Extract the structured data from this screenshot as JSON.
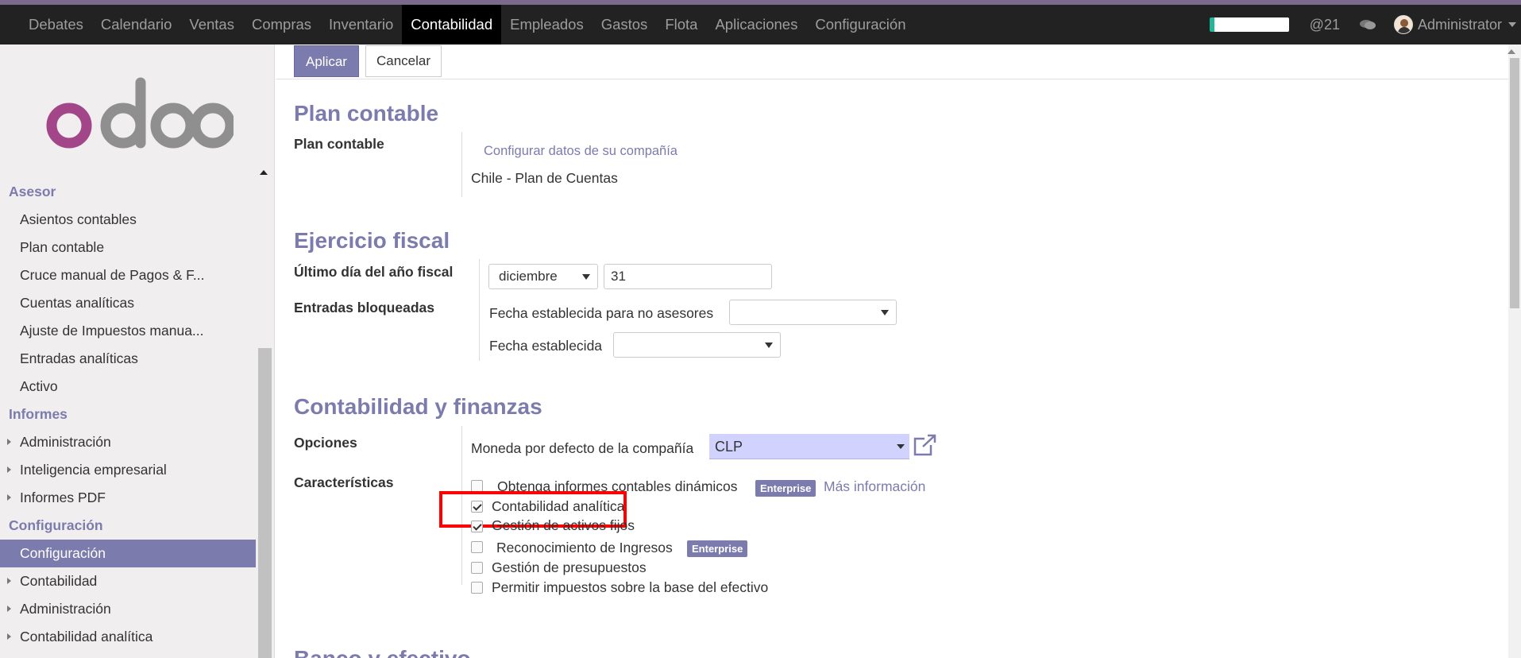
{
  "topnav": {
    "menu": [
      {
        "label": "Debates"
      },
      {
        "label": "Calendario"
      },
      {
        "label": "Ventas"
      },
      {
        "label": "Compras"
      },
      {
        "label": "Inventario"
      },
      {
        "label": "Contabilidad",
        "active": true
      },
      {
        "label": "Empleados"
      },
      {
        "label": "Gastos"
      },
      {
        "label": "Flota"
      },
      {
        "label": "Aplicaciones"
      },
      {
        "label": "Configuración"
      }
    ],
    "mentions": "@21",
    "user": "Administrator"
  },
  "sidebar": {
    "logo_text": "odoo",
    "sections": [
      {
        "title": "Asesor",
        "items": [
          "Asientos contables",
          "Plan contable",
          "Cruce manual de Pagos & F...",
          "Cuentas analíticas",
          "Ajuste de Impuestos manua...",
          "Entradas analíticas",
          "Activo"
        ]
      },
      {
        "title": "Informes",
        "items": [
          "Administración",
          "Inteligencia empresarial",
          "Informes PDF"
        ]
      },
      {
        "title": "Configuración",
        "items": [
          "Configuración",
          "Contabilidad",
          "Administración",
          "Contabilidad analítica"
        ]
      }
    ]
  },
  "toolbar": {
    "apply_label": "Aplicar",
    "cancel_label": "Cancelar"
  },
  "plan": {
    "title": "Plan contable",
    "label": "Plan contable",
    "configure_link": "Configurar datos de su compañía",
    "value": "Chile - Plan de Cuentas"
  },
  "fiscal": {
    "title": "Ejercicio fiscal",
    "last_day_label": "Último día del año fiscal",
    "month": "diciembre",
    "day": "31",
    "locked_label": "Entradas bloqueadas",
    "lock_non_advisers_label": "Fecha establecida para no asesores",
    "lock_date_label": "Fecha establecida"
  },
  "finance": {
    "title": "Contabilidad y finanzas",
    "options_label": "Opciones",
    "currency_label": "Moneda por defecto de la compañía",
    "currency": "CLP",
    "features_label": "Características",
    "features": [
      {
        "label": "Obtenga informes contables dinámicos",
        "checked": false,
        "badge": "Enterprise",
        "link": "Más información"
      },
      {
        "label": "Contabilidad analítica",
        "checked": true
      },
      {
        "label": "Gestión de activos fijos",
        "checked": true
      },
      {
        "label": "Reconocimiento de Ingresos",
        "checked": false,
        "badge": "Enterprise"
      },
      {
        "label": "Gestión de presupuestos",
        "checked": false
      },
      {
        "label": "Permitir impuestos sobre la base del efectivo",
        "checked": false
      }
    ]
  },
  "bank": {
    "title": "Banco y efectivo"
  },
  "colors": {
    "brand": "#7c7bad",
    "navbar": "#222222",
    "highlight": "#ff0000"
  }
}
